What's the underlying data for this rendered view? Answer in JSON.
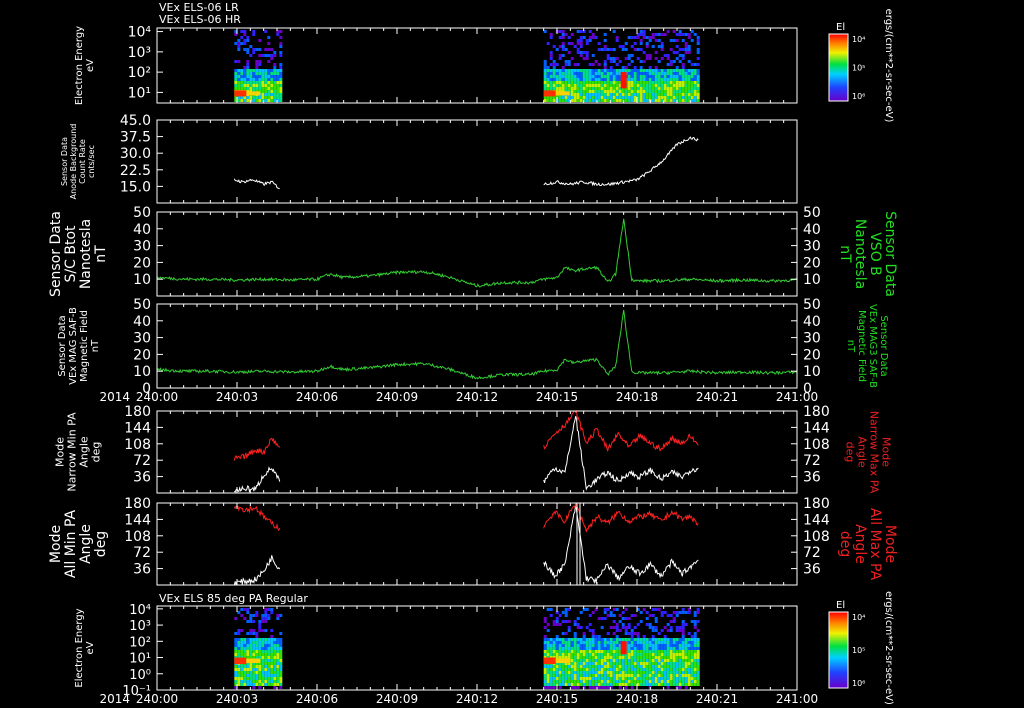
{
  "chart_data": [
    {
      "type": "heatmap",
      "titles": [
        "VEx ELS-06 LR",
        "VEx ELS-06 HR"
      ],
      "ylabel": [
        "Electron Energy",
        "eV"
      ],
      "y_scale": "log",
      "y_ticks": [
        "10⁴",
        "10³",
        "10²",
        "10¹"
      ],
      "ylim": [
        3,
        15000
      ],
      "time_coverage": [
        [
          "240:02.9",
          "240:04.6"
        ],
        [
          "240:14.5",
          "240:20.3"
        ]
      ],
      "colorbar": {
        "title": "El",
        "ticks": [
          "10⁴",
          "10⁵",
          "10⁶"
        ],
        "units": "ergs/(cm**2-sr-sec-eV)"
      }
    },
    {
      "type": "line",
      "ylabel": [
        "Sensor Data",
        "Anode Background",
        "Count Rate",
        "cnts/sec"
      ],
      "y_ticks": [
        "45.0",
        "37.5",
        "30.0",
        "22.5",
        "15.0"
      ],
      "ylim": [
        7.5,
        45
      ],
      "series": [
        {
          "color": "#ffffff",
          "x": [
            2.9,
            3.2,
            3.6,
            4.0,
            4.3,
            4.6
          ],
          "y": [
            18,
            17,
            18,
            16,
            17,
            14
          ]
        },
        {
          "color": "#ffffff",
          "x": [
            14.5,
            15.0,
            15.5,
            16.0,
            16.5,
            17.0,
            17.5,
            18.0,
            18.5,
            19.0,
            19.5,
            20.0,
            20.3
          ],
          "y": [
            16,
            17,
            16,
            17,
            16,
            16,
            17,
            18,
            22,
            27,
            34,
            37,
            36
          ]
        }
      ]
    },
    {
      "type": "line",
      "ylabel": [
        "Sensor Data",
        "S/C Btot",
        "Nanotesla",
        "nT"
      ],
      "ylabel_right": [
        "Sensor Data",
        "VSO B",
        "Nanotesla",
        "nT"
      ],
      "y_ticks": [
        "50",
        "40",
        "30",
        "20",
        "10"
      ],
      "ylim": [
        0,
        50
      ],
      "series": [
        {
          "color": "#33cc33",
          "x": [
            0,
            1,
            2,
            3,
            4,
            5,
            6,
            6.5,
            7,
            8,
            9,
            10,
            10.5,
            11,
            12,
            13,
            14,
            14.5,
            15,
            15.3,
            15.6,
            16,
            16.5,
            16.9,
            17.2,
            17.5,
            17.8,
            18,
            19,
            20,
            21,
            22,
            23,
            24
          ],
          "y": [
            11,
            10,
            10,
            9.5,
            10,
            9.5,
            10,
            13,
            11,
            12,
            14,
            14.5,
            13,
            11,
            6,
            8,
            8,
            10,
            11,
            17,
            15,
            16,
            17,
            8,
            13,
            46,
            10,
            9,
            9,
            10,
            9,
            9.5,
            9,
            9.5
          ]
        }
      ]
    },
    {
      "type": "line",
      "ylabel": [
        "Sensor Data",
        "VEx MAG SAF-B",
        "Magnetic Field",
        "nT"
      ],
      "ylabel_right": [
        "Sensor Data",
        "VEx MAG3 SAF-B",
        "Magnetic Field",
        "nT"
      ],
      "y_ticks": [
        "50",
        "40",
        "30",
        "20",
        "10",
        "0"
      ],
      "ylim": [
        0,
        50
      ],
      "x_ticks": [
        "240:00",
        "240:03",
        "240:06",
        "240:09",
        "240:12",
        "240:15",
        "240:18",
        "240:21",
        "241:00"
      ],
      "year_label": "2014",
      "series": [
        {
          "color": "#33cc33",
          "x": [
            0,
            1,
            2,
            3,
            4,
            5,
            6,
            6.5,
            7,
            8,
            9,
            10,
            10.5,
            11,
            12,
            13,
            14,
            14.5,
            15,
            15.3,
            15.6,
            16,
            16.5,
            16.9,
            17.2,
            17.5,
            17.8,
            18,
            19,
            20,
            21,
            22,
            23,
            24
          ],
          "y": [
            11,
            10,
            10,
            9.5,
            10,
            9.5,
            10,
            13,
            11,
            12,
            14,
            14.5,
            13,
            11,
            6,
            8,
            8,
            10,
            11,
            17,
            15,
            16,
            17,
            8,
            13,
            46,
            10,
            9,
            9,
            10,
            9,
            9.5,
            9,
            9.5
          ]
        }
      ]
    },
    {
      "type": "line",
      "ylabel": [
        "Mode",
        "Narrow Min PA",
        "Angle",
        "deg"
      ],
      "ylabel_right": [
        "Mode",
        "Narrow Max PA",
        "Angle",
        "deg"
      ],
      "y_ticks": [
        "180",
        "144",
        "108",
        "72",
        "36"
      ],
      "ylim": [
        0,
        180
      ],
      "series": [
        {
          "color": "#ffffff",
          "x": [
            2.9,
            3.3,
            3.7,
            4.0,
            4.3,
            4.6
          ],
          "y": [
            5,
            10,
            8,
            40,
            55,
            25
          ]
        },
        {
          "color": "#ff2020",
          "x": [
            2.9,
            3.3,
            3.7,
            4.0,
            4.3,
            4.6
          ],
          "y": [
            75,
            80,
            95,
            90,
            120,
            100
          ]
        },
        {
          "color": "#ffffff",
          "x": [
            14.5,
            14.9,
            15.3,
            15.7,
            16.1,
            16.5,
            16.9,
            17.3,
            17.7,
            18.1,
            18.5,
            18.9,
            19.3,
            19.7,
            20.0,
            20.3
          ],
          "y": [
            25,
            55,
            45,
            170,
            10,
            30,
            45,
            25,
            45,
            35,
            50,
            30,
            45,
            35,
            50,
            55
          ]
        },
        {
          "color": "#ff2020",
          "x": [
            14.5,
            14.9,
            15.3,
            15.7,
            16.1,
            16.5,
            16.9,
            17.3,
            17.7,
            18.1,
            18.5,
            18.9,
            19.3,
            19.7,
            20.0,
            20.3
          ],
          "y": [
            100,
            130,
            150,
            180,
            110,
            140,
            95,
            130,
            100,
            125,
            110,
            95,
            120,
            110,
            125,
            105
          ]
        }
      ]
    },
    {
      "type": "line",
      "ylabel": [
        "Mode",
        "All Min PA",
        "Angle",
        "deg"
      ],
      "ylabel_right": [
        "Mode",
        "All Max PA",
        "Angle",
        "deg"
      ],
      "y_ticks": [
        "180",
        "144",
        "108",
        "72",
        "36"
      ],
      "ylim": [
        0,
        180
      ],
      "series": [
        {
          "color": "#ffffff",
          "x": [
            2.9,
            3.3,
            3.7,
            4.0,
            4.3,
            4.6
          ],
          "y": [
            5,
            8,
            12,
            30,
            60,
            35
          ]
        },
        {
          "color": "#ff2020",
          "x": [
            2.9,
            3.3,
            3.7,
            4.0,
            4.3,
            4.6
          ],
          "y": [
            175,
            165,
            170,
            150,
            135,
            125
          ]
        },
        {
          "color": "#ffffff",
          "x": [
            14.5,
            14.9,
            15.3,
            15.7,
            16.1,
            16.5,
            16.9,
            17.3,
            17.7,
            18.1,
            18.5,
            18.9,
            19.3,
            19.7,
            20.0,
            20.3
          ],
          "y": [
            50,
            20,
            45,
            175,
            15,
            10,
            45,
            15,
            40,
            25,
            45,
            20,
            50,
            25,
            40,
            55
          ]
        },
        {
          "color": "#ff2020",
          "x": [
            14.5,
            14.9,
            15.3,
            15.7,
            16.1,
            16.5,
            16.9,
            17.3,
            17.7,
            18.1,
            18.5,
            18.9,
            19.3,
            19.7,
            20.0,
            20.3
          ],
          "y": [
            130,
            160,
            140,
            180,
            120,
            150,
            135,
            160,
            140,
            150,
            155,
            140,
            160,
            145,
            150,
            135
          ]
        }
      ]
    },
    {
      "type": "heatmap",
      "title": "VEx ELS 85 deg PA Regular",
      "ylabel": [
        "Electron Energy",
        "eV"
      ],
      "y_scale": "log",
      "y_ticks": [
        "10⁴",
        "10³",
        "10²",
        "10¹",
        "10⁰",
        "10⁻¹"
      ],
      "ylim": [
        0.1,
        15000
      ],
      "x_ticks": [
        "240:00",
        "240:03",
        "240:06",
        "240:09",
        "240:12",
        "240:15",
        "240:18",
        "240:21",
        "241:00"
      ],
      "year_label": "2014",
      "time_coverage": [
        [
          "240:02.9",
          "240:04.6"
        ],
        [
          "240:14.5",
          "240:20.3"
        ]
      ],
      "colorbar": {
        "title": "El",
        "ticks": [
          "10⁴",
          "10⁵",
          "10⁶"
        ],
        "units": "ergs/(cm**2-sr-sec-eV)"
      }
    }
  ]
}
